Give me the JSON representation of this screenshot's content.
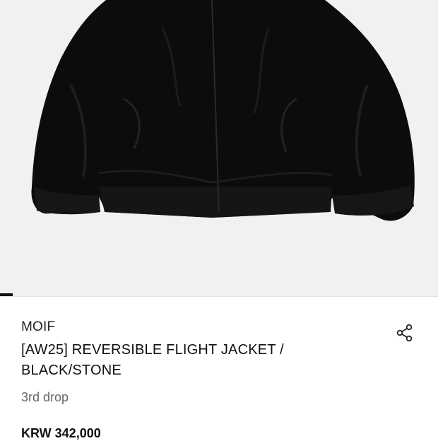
{
  "product": {
    "image_icon": "black-flight-jacket-photo",
    "image_count": 1,
    "active_image": 1,
    "brand": "MOIF",
    "title": "[AW25] REVERSIBLE FLIGHT JACKET / BLACK/STONE",
    "subtitle": "3rd drop",
    "price": "KRW 342,000"
  },
  "actions": {
    "share_icon": "share-icon"
  },
  "colors": {
    "hero_background": "#f1f1f1",
    "text_primary": "#111111",
    "text_secondary": "#666666",
    "indicator": "#111111"
  }
}
